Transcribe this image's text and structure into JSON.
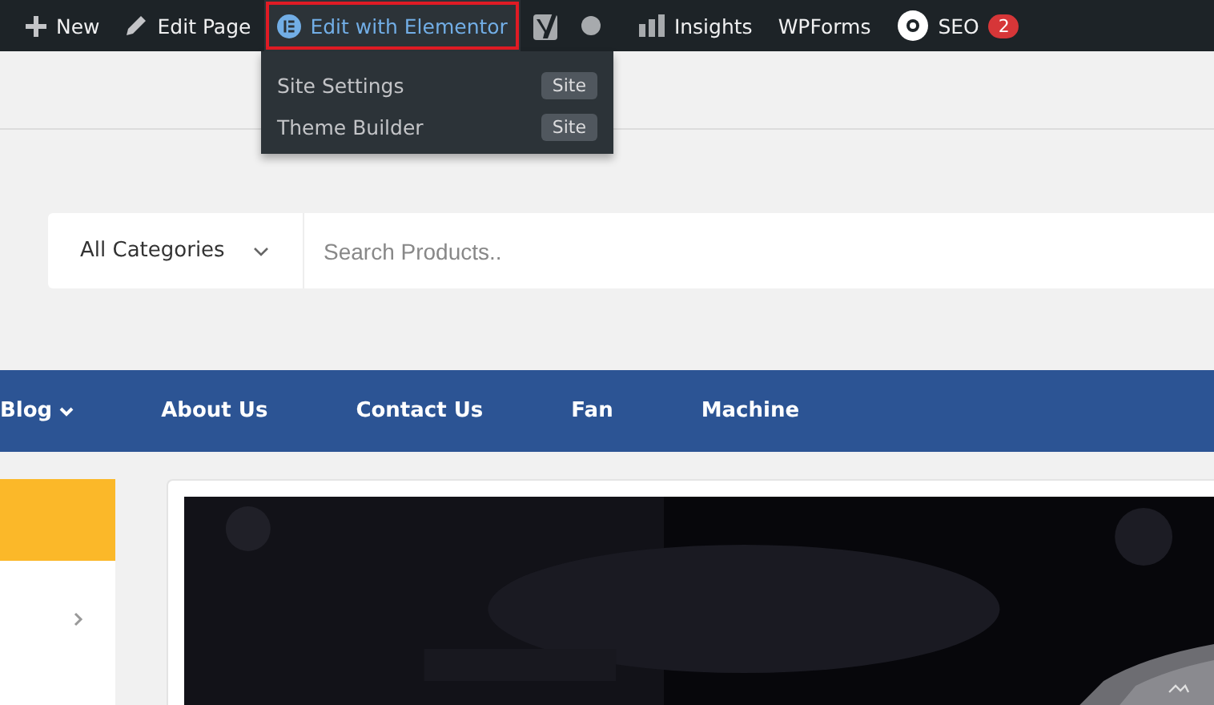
{
  "admin_bar": {
    "items": [
      {
        "kind": "new",
        "label": "New"
      },
      {
        "kind": "edit",
        "label": "Edit Page"
      },
      {
        "kind": "elementor",
        "label": "Edit with Elementor",
        "highlighted": true
      },
      {
        "kind": "yoast"
      },
      {
        "kind": "dot"
      },
      {
        "kind": "insights",
        "label": "Insights"
      },
      {
        "kind": "plain",
        "label": "WPForms"
      },
      {
        "kind": "seo",
        "label": "SEO",
        "badge": "2"
      }
    ],
    "dropdown": [
      {
        "label": "Site Settings",
        "tag": "Site"
      },
      {
        "label": "Theme Builder",
        "tag": "Site"
      }
    ]
  },
  "search": {
    "category": "All Categories",
    "placeholder": "Search Products.."
  },
  "nav": [
    {
      "label": "Blog",
      "has_caret": true
    },
    {
      "label": "About Us",
      "has_caret": false
    },
    {
      "label": "Contact Us",
      "has_caret": false
    },
    {
      "label": "Fan",
      "has_caret": false
    },
    {
      "label": "Machine",
      "has_caret": false
    }
  ]
}
